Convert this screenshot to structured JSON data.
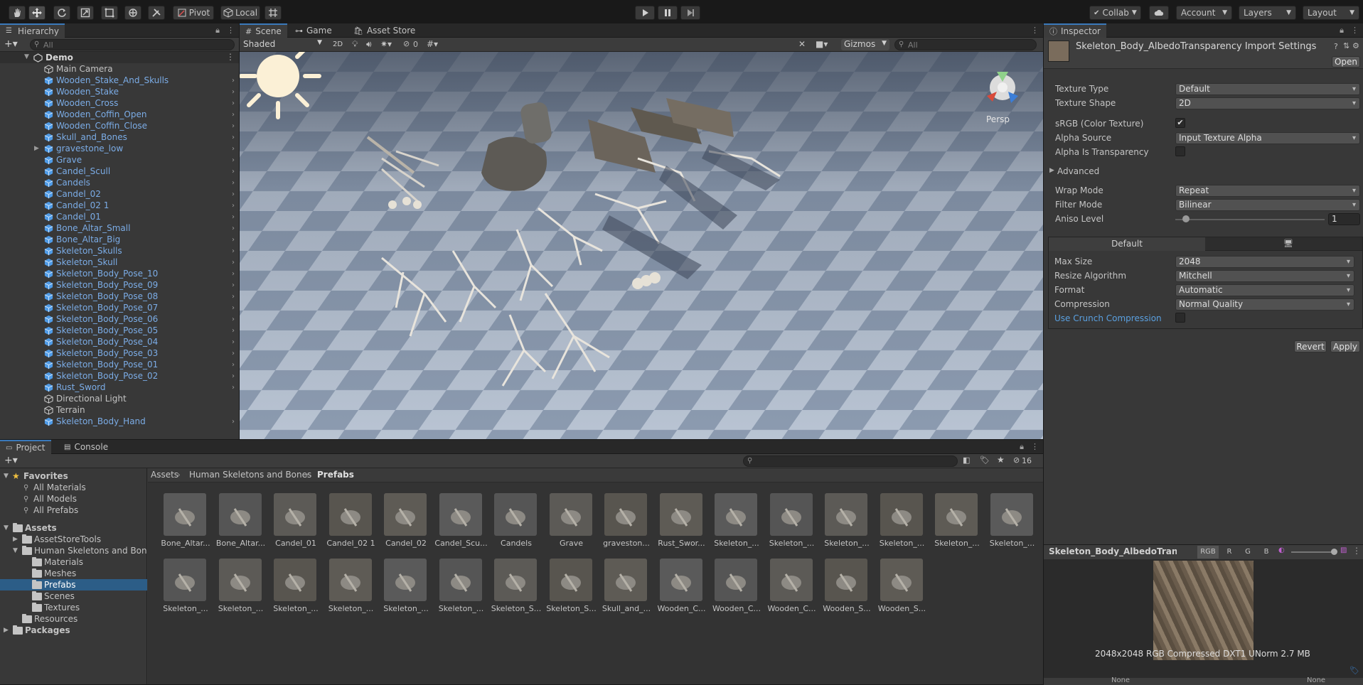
{
  "toolbar": {
    "pivot": "Pivot",
    "local": "Local",
    "collab": "Collab",
    "account": "Account",
    "layers": "Layers",
    "layout": "Layout"
  },
  "hierarchy": {
    "tab": "Hierarchy",
    "search_placeholder": "All",
    "scene": "Demo",
    "items": [
      {
        "label": "Main Camera",
        "prefab": false
      },
      {
        "label": "Wooden_Stake_And_Skulls",
        "prefab": true
      },
      {
        "label": "Wooden_Stake",
        "prefab": true
      },
      {
        "label": "Wooden_Cross",
        "prefab": true
      },
      {
        "label": "Wooden_Coffin_Open",
        "prefab": true
      },
      {
        "label": "Wooden_Coffin_Close",
        "prefab": true
      },
      {
        "label": "Skull_and_Bones",
        "prefab": true
      },
      {
        "label": "gravestone_low",
        "prefab": true
      },
      {
        "label": "Grave",
        "prefab": true
      },
      {
        "label": "Candel_Scull",
        "prefab": true
      },
      {
        "label": "Candels",
        "prefab": true
      },
      {
        "label": "Candel_02",
        "prefab": true
      },
      {
        "label": "Candel_02 1",
        "prefab": true
      },
      {
        "label": "Candel_01",
        "prefab": true
      },
      {
        "label": "Bone_Altar_Small",
        "prefab": true
      },
      {
        "label": "Bone_Altar_Big",
        "prefab": true
      },
      {
        "label": "Skeleton_Skulls",
        "prefab": true
      },
      {
        "label": "Skeleton_Skull",
        "prefab": true
      },
      {
        "label": "Skeleton_Body_Pose_10",
        "prefab": true
      },
      {
        "label": "Skeleton_Body_Pose_09",
        "prefab": true
      },
      {
        "label": "Skeleton_Body_Pose_08",
        "prefab": true
      },
      {
        "label": "Skeleton_Body_Pose_07",
        "prefab": true
      },
      {
        "label": "Skeleton_Body_Pose_06",
        "prefab": true
      },
      {
        "label": "Skeleton_Body_Pose_05",
        "prefab": true
      },
      {
        "label": "Skeleton_Body_Pose_04",
        "prefab": true
      },
      {
        "label": "Skeleton_Body_Pose_03",
        "prefab": true
      },
      {
        "label": "Skeleton_Body_Pose_01",
        "prefab": true
      },
      {
        "label": "Skeleton_Body_Pose_02",
        "prefab": true
      },
      {
        "label": "Rust_Sword",
        "prefab": true
      },
      {
        "label": "Directional Light",
        "prefab": false
      },
      {
        "label": "Terrain",
        "prefab": false
      },
      {
        "label": "Skeleton_Body_Hand",
        "prefab": true
      }
    ]
  },
  "scene_view": {
    "tabs": [
      "Scene",
      "Game",
      "Asset Store"
    ],
    "shading": "Shaded",
    "mode_2d": "2D",
    "hidden_count": "0",
    "gizmos": "Gizmos",
    "search_placeholder": "All",
    "persp": "Persp"
  },
  "inspector": {
    "tab": "Inspector",
    "title": "Skeleton_Body_AlbedoTransparency Import Settings",
    "open": "Open",
    "fields": {
      "texture_type_label": "Texture Type",
      "texture_type": "Default",
      "texture_shape_label": "Texture Shape",
      "texture_shape": "2D",
      "srgb_label": "sRGB (Color Texture)",
      "srgb_check": "✔",
      "alpha_source_label": "Alpha Source",
      "alpha_source": "Input Texture Alpha",
      "alpha_is_transparency_label": "Alpha Is Transparency",
      "advanced_label": "Advanced",
      "wrap_mode_label": "Wrap Mode",
      "wrap_mode": "Repeat",
      "filter_mode_label": "Filter Mode",
      "filter_mode": "Bilinear",
      "aniso_label": "Aniso Level",
      "aniso_value": "1"
    },
    "platform_tab": "Default",
    "platform": {
      "max_size_label": "Max Size",
      "max_size": "2048",
      "resize_label": "Resize Algorithm",
      "resize": "Mitchell",
      "format_label": "Format",
      "format": "Automatic",
      "compression_label": "Compression",
      "compression": "Normal Quality",
      "crunch_label": "Use Crunch Compression"
    },
    "revert": "Revert",
    "apply": "Apply",
    "preview": {
      "title": "Skeleton_Body_AlbedoTranspa",
      "channels": [
        "RGB",
        "R",
        "G",
        "B"
      ],
      "info": "2048x2048  RGB Compressed DXT1 UNorm   2.7 MB",
      "footer_a": "None",
      "footer_b": "None"
    }
  },
  "project": {
    "tabs": [
      "Project",
      "Console"
    ],
    "hidden_count": "16",
    "favorites_label": "Favorites",
    "favorites": [
      "All Materials",
      "All Models",
      "All Prefabs"
    ],
    "assets_label": "Assets",
    "tree": [
      {
        "label": "AssetStoreTools"
      },
      {
        "label": "Human Skeletons and Bones"
      },
      {
        "label": "Materials"
      },
      {
        "label": "Meshes"
      },
      {
        "label": "Prefabs"
      },
      {
        "label": "Scenes"
      },
      {
        "label": "Textures"
      },
      {
        "label": "Resources"
      }
    ],
    "packages_label": "Packages",
    "breadcrumb": [
      "Assets",
      "Human Skeletons and Bones",
      "Prefabs"
    ],
    "assets_row1": [
      "Bone_Altar...",
      "Bone_Altar...",
      "Candel_01",
      "Candel_02 1",
      "Candel_02",
      "Candel_Scu...",
      "Candels",
      "Grave",
      "graveston...",
      "Rust_Swor...",
      "Skeleton_...",
      "Skeleton_...",
      "Skeleton_...",
      "Skeleton_...",
      "Skeleton_...",
      "Skeleton_..."
    ],
    "assets_row2": [
      "Skeleton_...",
      "Skeleton_...",
      "Skeleton_...",
      "Skeleton_...",
      "Skeleton_...",
      "Skeleton_...",
      "Skeleton_S...",
      "Skeleton_S...",
      "Skull_and_...",
      "Wooden_C...",
      "Wooden_C...",
      "Wooden_C...",
      "Wooden_S...",
      "Wooden_S..."
    ]
  }
}
